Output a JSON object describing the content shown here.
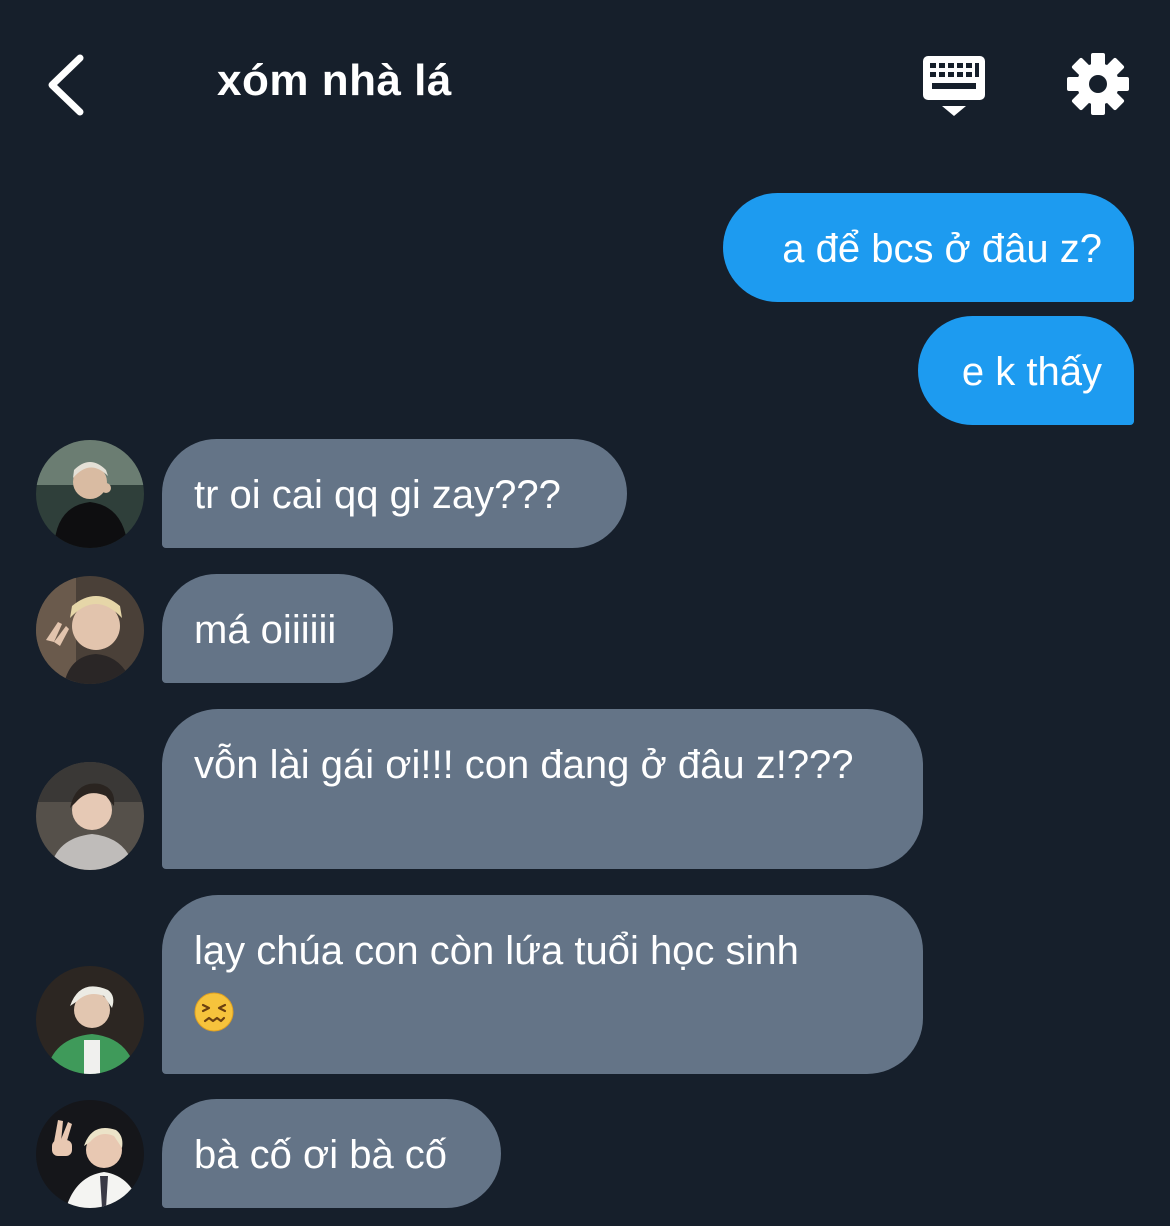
{
  "header": {
    "title": "xóm nhà lá",
    "back_icon": "chevron-left-icon",
    "keyboard_icon": "keyboard-icon",
    "settings_icon": "gear-icon"
  },
  "colors": {
    "background": "#161f2b",
    "outgoing_bubble": "#1d9bf0",
    "incoming_bubble": "#647487",
    "text": "#ffffff"
  },
  "messages": [
    {
      "direction": "outgoing",
      "text": "a để bcs ở đâu z?"
    },
    {
      "direction": "outgoing",
      "text": "e k thấy"
    },
    {
      "direction": "incoming",
      "text": "tr oi cai qq gi zay???"
    },
    {
      "direction": "incoming",
      "text": "má oiiiiii"
    },
    {
      "direction": "incoming",
      "text": "vỗn lài gái ơi!!! con đang ở đâu z!???"
    },
    {
      "direction": "incoming",
      "text": "lạy chúa con còn lứa tuổi học sinh",
      "emoji": "confounded-face-emoji"
    },
    {
      "direction": "incoming",
      "text": "bà cố ơi bà cố"
    }
  ]
}
